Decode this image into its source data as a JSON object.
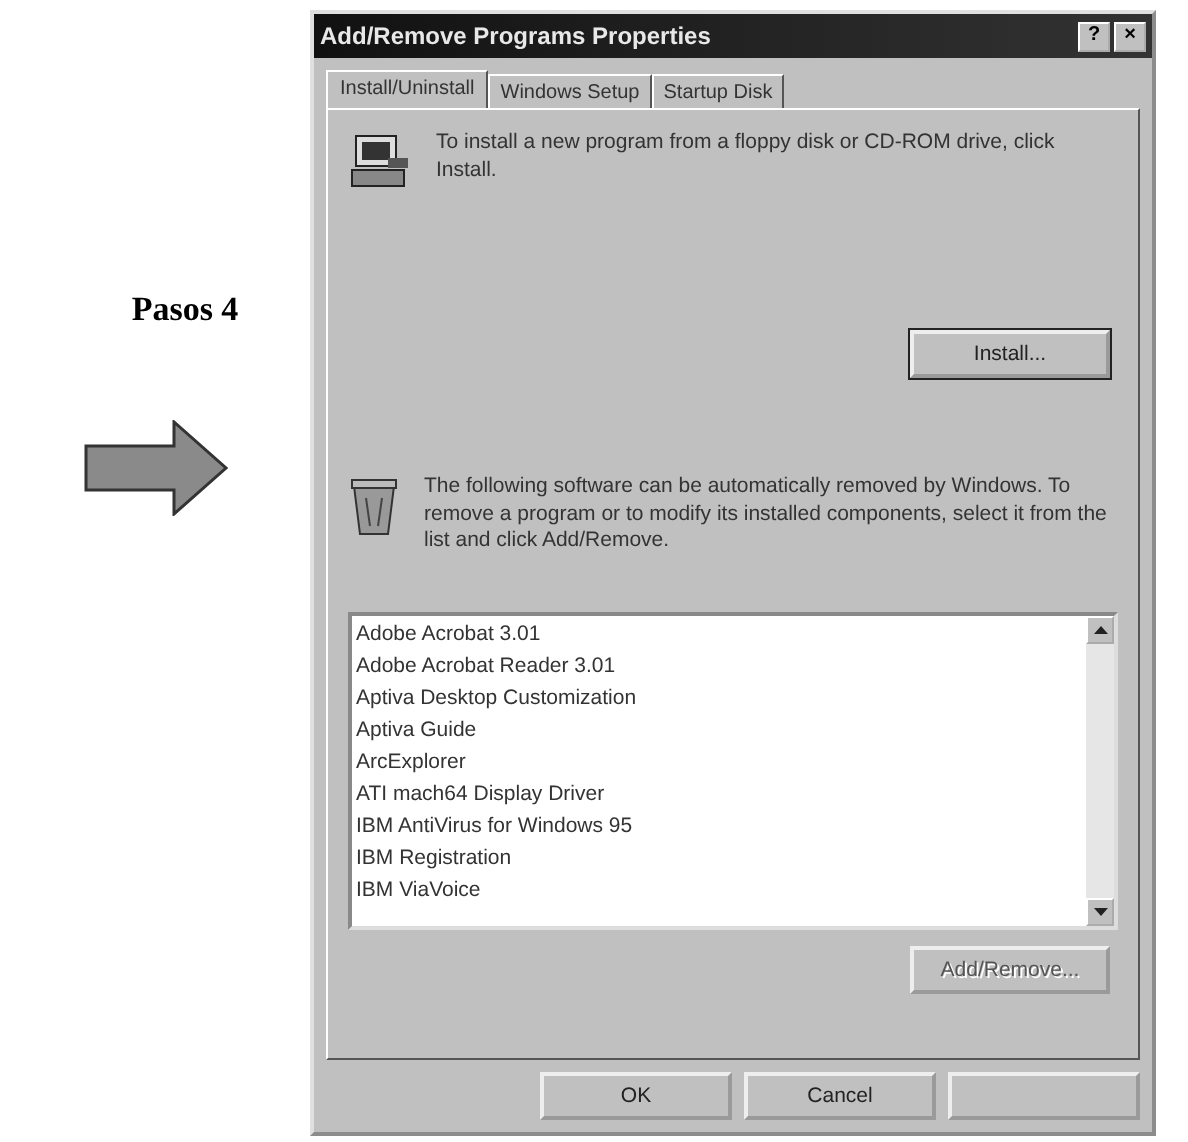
{
  "caption": "Pasos 4",
  "window": {
    "title": "Add/Remove Programs Properties",
    "title_buttons": [
      "?",
      "×"
    ]
  },
  "tabs": [
    {
      "label": "Install/Uninstall",
      "selected": true
    },
    {
      "label": "Windows Setup",
      "selected": false
    },
    {
      "label": "Startup Disk",
      "selected": false
    }
  ],
  "install": {
    "text": "To install a new program from a floppy disk or CD-ROM drive, click Install.",
    "button": {
      "label": "Install...",
      "disabled": false
    }
  },
  "remove": {
    "text": "The following software can be automatically removed by Windows. To remove a program or to modify its installed components, select it from the list and click Add/Remove.",
    "programs": [
      {
        "name": "Adobe Acrobat 3.01",
        "selected": false
      },
      {
        "name": "Adobe Acrobat Reader 3.01",
        "selected": false
      },
      {
        "name": "Aptiva Desktop Customization",
        "selected": false
      },
      {
        "name": "Aptiva Guide",
        "selected": false
      },
      {
        "name": "ArcExplorer",
        "selected": false
      },
      {
        "name": "ATI mach64 Display Driver",
        "selected": false
      },
      {
        "name": "IBM AntiVirus for Windows 95",
        "selected": false
      },
      {
        "name": "IBM Registration",
        "selected": false
      },
      {
        "name": "IBM ViaVoice",
        "selected": false
      }
    ],
    "button": {
      "label": "Add/Remove...",
      "disabled": true
    }
  },
  "buttons": [
    {
      "label": "OK",
      "disabled": false
    },
    {
      "label": "Cancel",
      "disabled": false
    }
  ]
}
